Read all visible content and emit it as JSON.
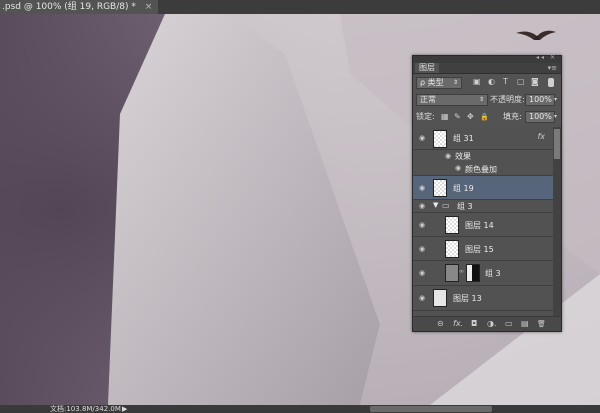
{
  "document_tab": {
    "title": ".psd @ 100% (组 19, RGB/8) *",
    "close": "×"
  },
  "status_bar": {
    "zoom": "",
    "doc_info": "文档:103.8M/342.0M",
    "arrow": "▶"
  },
  "layers_panel": {
    "titlebar_buttons": "◂◂ ✕",
    "tab_label": "图层",
    "menu_icon": "▾≡",
    "filter": {
      "kind_label": "ρ 类型",
      "icons": [
        "image-filter-icon",
        "adjustment-filter-icon",
        "type-filter-icon",
        "shape-filter-icon",
        "smart-object-filter-icon"
      ],
      "glyphs": [
        "▣",
        "◐",
        "T",
        "▢",
        "◙"
      ]
    },
    "blend_mode": "正常",
    "opacity_label": "不透明度:",
    "opacity_value": "100%",
    "lock_label": "锁定:",
    "lock_glyphs": [
      "▦",
      "✎",
      "✥",
      "🔒"
    ],
    "fill_label": "填充:",
    "fill_value": "100%",
    "layers": [
      {
        "name": "组 31",
        "has_fx": true,
        "fx_label": "fx",
        "type": "group-thumb"
      },
      {
        "name": "效果",
        "type": "effects-header"
      },
      {
        "name": "颜色叠加",
        "type": "effect"
      },
      {
        "name": "组 19",
        "type": "group-thumb",
        "selected": true
      },
      {
        "name": "组 3",
        "type": "folder",
        "expanded": true
      },
      {
        "name": "图层 14",
        "type": "layer"
      },
      {
        "name": "图层 15",
        "type": "layer"
      },
      {
        "name": "组 3",
        "type": "masked-group"
      },
      {
        "name": "图层 13",
        "type": "layer"
      }
    ],
    "footer_glyphs": [
      "⊝",
      "fx.",
      "◘",
      "◑.",
      "▭",
      "▤",
      "🗑"
    ]
  },
  "colors": {
    "panel_bg": "#535353",
    "selected_row": "#56657a",
    "canvas_mid": "#c9c2c7"
  }
}
